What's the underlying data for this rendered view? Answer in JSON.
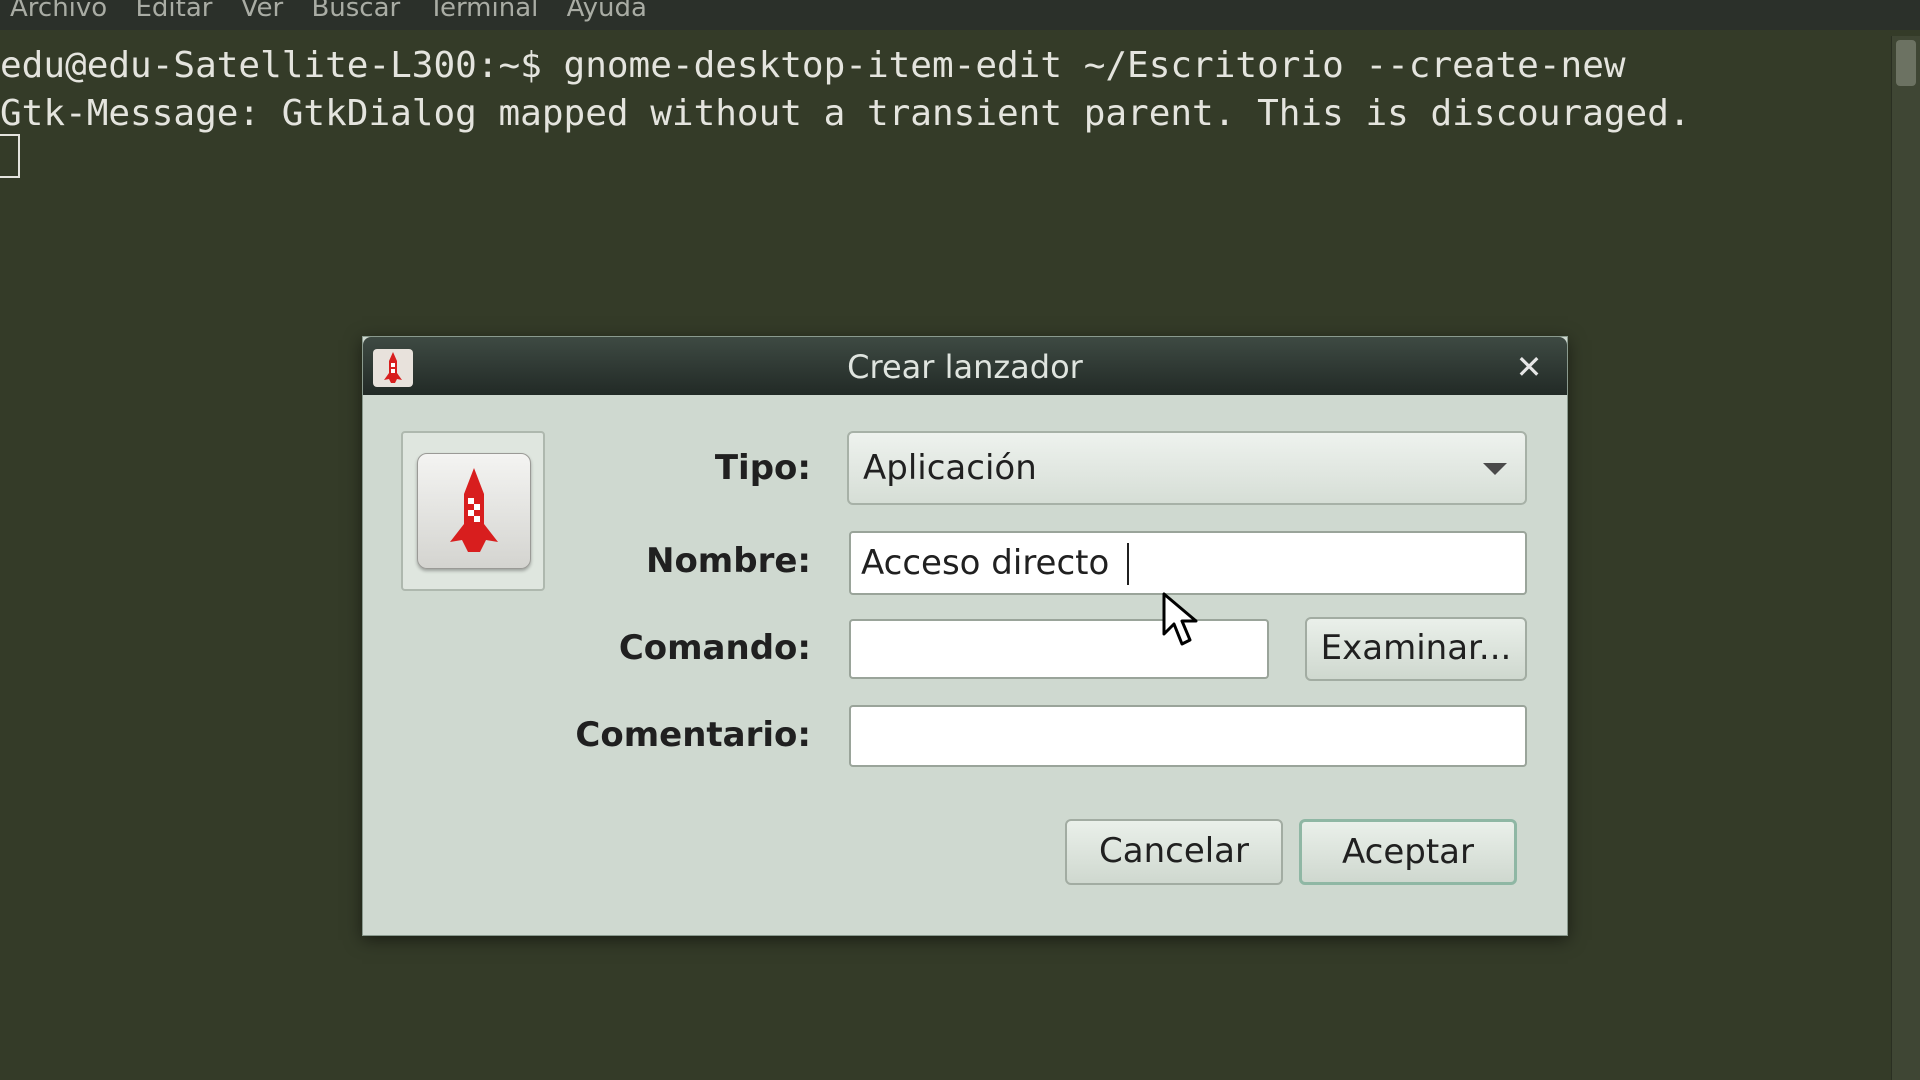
{
  "terminal": {
    "menu": [
      "Archivo",
      "Editar",
      "Ver",
      "Buscar",
      "Terminal",
      "Ayuda"
    ],
    "lines": [
      "edu@edu-Satellite-L300:~$ gnome-desktop-item-edit ~/Escritorio --create-new",
      "Gtk-Message: GtkDialog mapped without a transient parent. This is discouraged."
    ]
  },
  "dialog": {
    "title": "Crear lanzador",
    "icon": "rocket-icon",
    "fields": {
      "tipo": {
        "label": "Tipo:",
        "value": "Aplicación"
      },
      "nombre": {
        "label": "Nombre:",
        "value": "Acceso directo"
      },
      "comando": {
        "label": "Comando:",
        "value": ""
      },
      "comentario": {
        "label": "Comentario:",
        "value": ""
      }
    },
    "buttons": {
      "browse": "Examinar...",
      "cancel": "Cancelar",
      "ok": "Aceptar"
    }
  },
  "colors": {
    "terminal_bg": "#343b28",
    "dialog_bg": "#cfd9d0",
    "rocket_red": "#d81e1e"
  }
}
